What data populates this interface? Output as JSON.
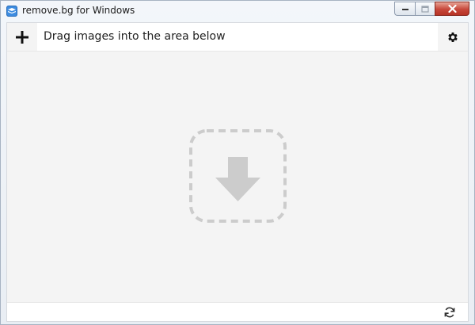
{
  "window": {
    "title": "remove.bg for Windows",
    "controls": [
      "minimize",
      "maximize",
      "close"
    ]
  },
  "toolbar": {
    "add_icon": "plus-icon",
    "instruction": "Drag images into the area below",
    "settings_icon": "gear-icon"
  },
  "dropzone": {
    "icon": "download-arrow-icon",
    "frame": "dashed-rounded-square"
  },
  "statusbar": {
    "refresh_icon": "refresh-icon"
  },
  "colors": {
    "canvas": "#f4f4f4",
    "toolbar": "#ffffff",
    "drop_icon": "#cccccc",
    "close_button": "#c7473a",
    "app_icon": "#3d8ce0"
  }
}
